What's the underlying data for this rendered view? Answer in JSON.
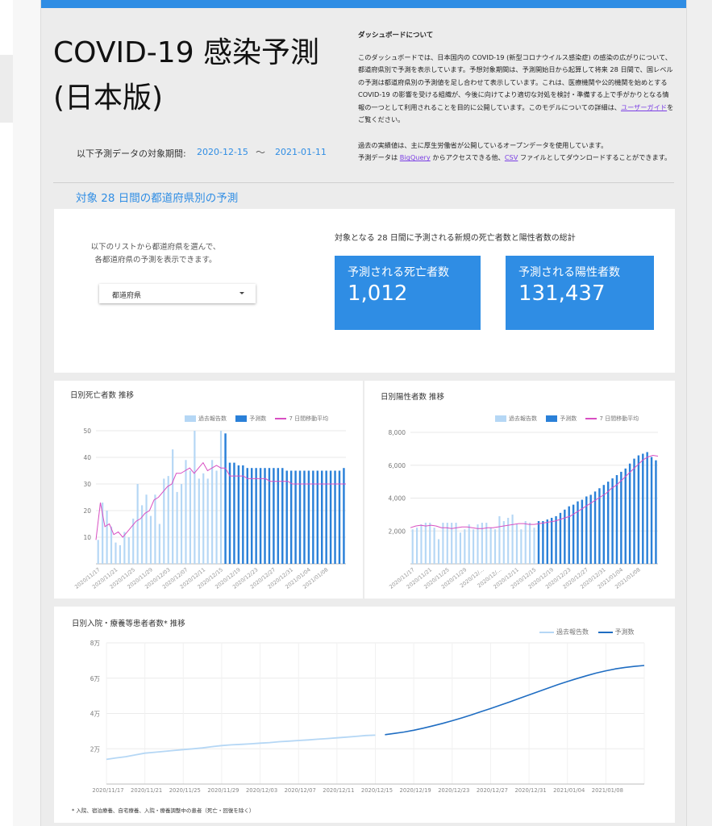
{
  "header": {
    "title_line1": "COVID-19 感染予測",
    "title_line2": "(日本版)",
    "period_label": "以下予測データの対象期間:",
    "period_start": "2020-12-15",
    "period_sep": "〜",
    "period_end": "2021-01-11"
  },
  "about": {
    "heading": "ダッシュボードについて",
    "p1_a": "このダッシュボードでは、日本国内の COVID-19 (新型コロナウイルス感染症) の感染の広がりについて、都道府県別で予測を表示しています。予想対象期間は、予測開始日から起算して将来 28 日間で、国レベルの予測は都道府県別の予測値を足し合わせて表示しています。これは、医療機関や公的機関を始めとする COVID-19 の影響を受ける組織が、今後に向けてより適切な対処を検討・準備する上で手がかりとなる情報の一つとして利用されることを目的に公開しています。このモデルについての詳細は、",
    "p1_link": "ユーザーガイド",
    "p1_b": "をご覧ください。",
    "p2_line1": "過去の実績値は、主に厚生労働省が公開しているオープンデータを使用しています。",
    "p2_a": "予測データは",
    "p2_link1": "BigQuery",
    "p2_b": "からアクセスできる他、",
    "p2_link2": "CSV",
    "p2_c": "ファイルとしてダウンロードすることができます。"
  },
  "section": {
    "title": "対象 28 日間の都道府県別の予測"
  },
  "prefecture": {
    "hint_line1": "以下のリストから都道府県を選んで、",
    "hint_line2": "各都道府県の予測を表示できます。",
    "dropdown_value": "都道府県"
  },
  "totals": {
    "label": "対象となる 28 日間に予測される新規の死亡者数と陽性者数の総計",
    "deaths_label": "予測される死亡者数",
    "deaths_value": "1,012",
    "positives_label": "予測される陽性者数",
    "positives_value": "131,437"
  },
  "colors": {
    "accent": "#2f8de4",
    "reported": "#b5d7f5",
    "forecast": "#2a80d8",
    "moving_avg": "#d84fc2",
    "hosp_past": "#b5d7f5",
    "hosp_forecast": "#1f6dc2"
  },
  "chart_data": [
    {
      "type": "bar",
      "title": "日別死亡者数 推移",
      "legend": [
        "過去報告数",
        "予測数",
        "7 日間移動平均"
      ],
      "ylim": [
        0,
        50
      ],
      "yticks": [
        "10",
        "20",
        "30",
        "40",
        "50"
      ],
      "xtick_labels": [
        "2020/11/17",
        "2020/11/21",
        "2020/11/25",
        "2020/11/29",
        "2020/12/03",
        "2020/12/07",
        "2020/12/11",
        "2020/12/15",
        "2020/12/19",
        "2020/12/23",
        "2020/12/27",
        "2020/12/31",
        "2021/01/04",
        "2021/01/08"
      ],
      "reported": [
        9,
        23,
        20,
        14,
        8,
        7,
        12,
        10,
        17,
        30,
        22,
        26,
        18,
        26,
        15,
        32,
        33,
        43,
        27,
        30,
        39,
        35,
        50,
        32,
        34,
        32,
        39,
        35,
        50
      ],
      "forecast": [
        49,
        38,
        38,
        37,
        37,
        36,
        36,
        36,
        36,
        36,
        36,
        36,
        36,
        36,
        35,
        35,
        35,
        35,
        35,
        35,
        35,
        35,
        35,
        35,
        35,
        35,
        35,
        36
      ],
      "moving_avg": [
        9,
        23,
        14,
        15,
        11,
        12,
        10,
        12,
        14,
        16,
        17,
        19,
        20,
        24,
        25,
        27,
        29,
        30,
        34,
        34,
        35,
        36,
        34,
        36,
        38,
        35,
        36,
        37,
        36,
        36,
        33,
        33,
        33,
        33,
        32,
        32,
        32,
        32,
        32,
        31,
        31,
        31,
        31,
        31,
        30,
        30,
        30,
        30,
        30,
        30,
        30,
        30,
        30,
        30,
        30,
        30,
        30
      ]
    },
    {
      "type": "bar",
      "title": "日別陽性者数 推移",
      "legend": [
        "過去報告数",
        "予測数",
        "7 日間移動平均"
      ],
      "ylim": [
        0,
        8000
      ],
      "yticks": [
        "2,000",
        "4,000",
        "6,000",
        "8,000"
      ],
      "xtick_labels": [
        "2020/11/17",
        "2020/11/21",
        "2020/11/25",
        "2020/11/29",
        "2020/12/...",
        "2020/12/...",
        "2020/12/11",
        "2020/12/15",
        "2020/12/19",
        "2020/12/23",
        "2020/12/27",
        "2020/12/31",
        "2021/01/04",
        "2021/01/08"
      ],
      "reported": [
        2100,
        2200,
        2400,
        2500,
        2500,
        2200,
        1500,
        2500,
        2500,
        2500,
        2500,
        1900,
        2100,
        2400,
        2100,
        2400,
        2500,
        2500,
        2200,
        2100,
        2900,
        2600,
        2800,
        3000,
        2400,
        2100,
        2600,
        2500,
        2200
      ],
      "forecast": [
        2600,
        2600,
        2700,
        2800,
        2900,
        3100,
        3300,
        3500,
        3600,
        3800,
        3900,
        4100,
        4200,
        4400,
        4600,
        4800,
        5000,
        5200,
        5400,
        5600,
        5800,
        6100,
        6400,
        6600,
        6700,
        6800,
        6500,
        6300
      ],
      "moving_avg": [
        2200,
        2300,
        2350,
        2300,
        2350,
        2300,
        2200,
        2200,
        2150,
        2200,
        2250,
        2250,
        2200,
        2150,
        2150,
        2200,
        2200,
        2250,
        2300,
        2350,
        2400,
        2450,
        2450,
        2400,
        2400,
        2450,
        2500,
        2550,
        2600,
        2700,
        2800,
        2900,
        3100,
        3300,
        3500,
        3700,
        3900,
        4100,
        4300,
        4600,
        4800,
        5100,
        5400,
        5700,
        6000,
        6300,
        6500,
        6600,
        6550
      ]
    },
    {
      "type": "line",
      "title": "日別入院・療養等患者者数* 推移",
      "legend": [
        "過去報告数",
        "予測数"
      ],
      "ylim": [
        0,
        80000
      ],
      "yticks": [
        "2万",
        "4万",
        "6万",
        "8万"
      ],
      "xtick_labels": [
        "2020/11/17",
        "2020/11/21",
        "2020/11/25",
        "2020/11/29",
        "2020/12/03",
        "2020/12/07",
        "2020/12/11",
        "2020/12/15",
        "2020/12/19",
        "2020/12/23",
        "2020/12/27",
        "2020/12/31",
        "2021/01/04",
        "2021/01/08"
      ],
      "past": [
        14000,
        14800,
        15500,
        16500,
        17500,
        18000,
        18500,
        19000,
        19500,
        20000,
        20500,
        21200,
        21800,
        22200,
        22500,
        22800,
        23200,
        23500,
        24000,
        24300,
        24700,
        25000,
        25400,
        25800,
        26200,
        26600,
        27000,
        27500,
        27700
      ],
      "forecast": [
        28000,
        28700,
        29500,
        30500,
        31700,
        33000,
        34400,
        35900,
        37500,
        39200,
        41000,
        42800,
        44700,
        46600,
        48600,
        50500,
        52500,
        54400,
        56300,
        58100,
        59800,
        61400,
        62900,
        64200,
        65300,
        66100,
        66700,
        67200
      ]
    }
  ],
  "footnote": "* 入院、宿泊療養、自宅療養、入院・療養調整中の患者（死亡・回復を除く）"
}
